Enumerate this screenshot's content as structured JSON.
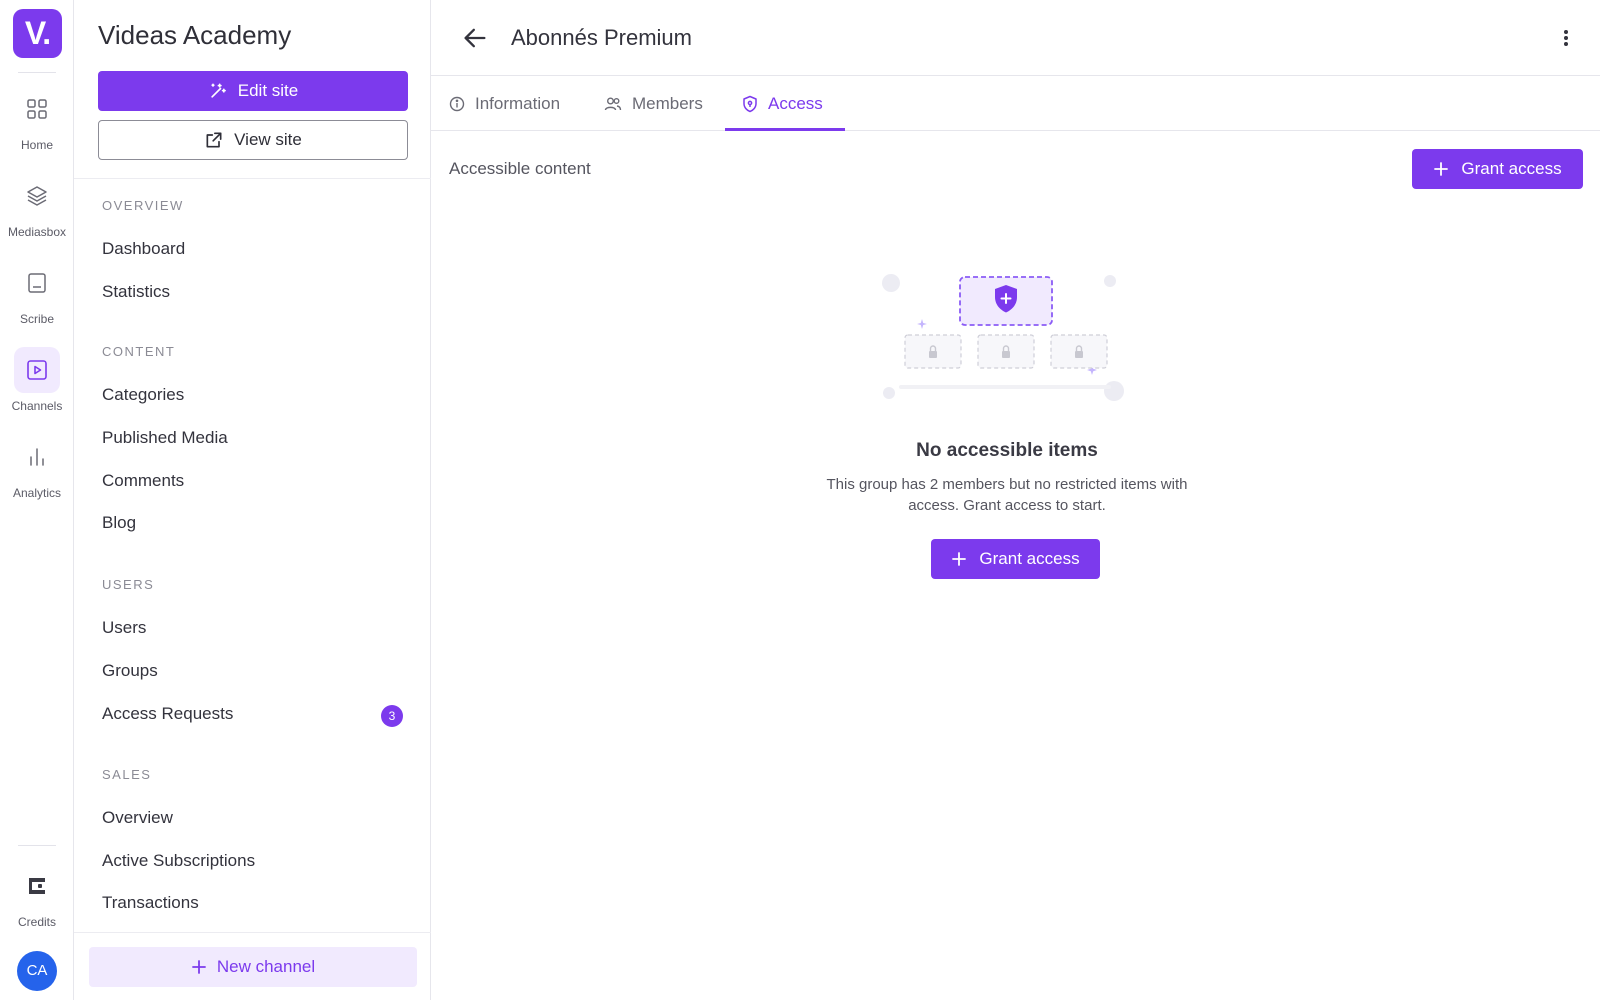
{
  "rail": {
    "logo": "V.",
    "items": [
      {
        "label": "Home",
        "icon": "grid-icon"
      },
      {
        "label": "Mediasbox",
        "icon": "layers-icon"
      },
      {
        "label": "Scribe",
        "icon": "subtitles-icon"
      },
      {
        "label": "Channels",
        "icon": "play-square-icon",
        "active": true
      },
      {
        "label": "Analytics",
        "icon": "bar-chart-icon"
      }
    ],
    "credits": {
      "label": "Credits",
      "icon": "wallet-icon"
    },
    "avatar": "CA"
  },
  "sidebar": {
    "title": "Videas Academy",
    "edit_label": "Edit site",
    "view_label": "View site",
    "sections": [
      {
        "label": "OVERVIEW",
        "items": [
          "Dashboard",
          "Statistics"
        ]
      },
      {
        "label": "CONTENT",
        "items": [
          "Categories",
          "Published Media",
          "Comments",
          "Blog"
        ]
      },
      {
        "label": "USERS",
        "items": [
          "Users",
          "Groups",
          "Access Requests"
        ]
      },
      {
        "label": "SALES",
        "items": [
          "Overview",
          "Active Subscriptions",
          "Transactions"
        ]
      }
    ],
    "access_requests_badge": "3",
    "new_channel_label": "New channel"
  },
  "header": {
    "title": "Abonnés Premium"
  },
  "tabs": [
    {
      "label": "Information",
      "icon": "info-icon"
    },
    {
      "label": "Members",
      "icon": "users-icon"
    },
    {
      "label": "Access",
      "icon": "shield-icon",
      "active": true
    }
  ],
  "content": {
    "section_title": "Accessible content",
    "grant_label": "Grant access",
    "empty_title": "No accessible items",
    "empty_text": "This group has 2 members but no restricted items with access. Grant access to start.",
    "grant_center_label": "Grant access"
  },
  "colors": {
    "accent": "#7c3aed",
    "accent_light": "#f1eafe",
    "avatar": "#2563eb"
  }
}
